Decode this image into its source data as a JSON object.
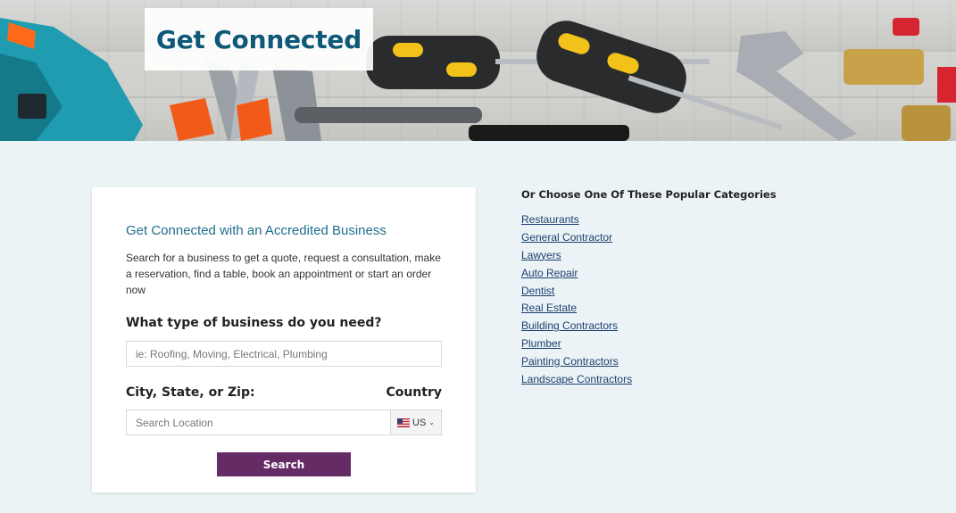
{
  "hero": {
    "title": "Get Connected"
  },
  "card": {
    "heading": "Get Connected with an Accredited Business",
    "description": "Search for a business to get a quote, request a consultation, make a reservation, find a table, book an appointment or start an order now",
    "business_label": "What type of business do you need?",
    "business_placeholder": "ie: Roofing, Moving, Electrical, Plumbing",
    "location_label": "City, State, or Zip:",
    "country_label": "Country",
    "location_placeholder": "Search Location",
    "country_value": "US",
    "search_button": "Search"
  },
  "categories": {
    "heading": "Or Choose One Of These Popular Categories",
    "items": [
      "Restaurants",
      "General Contractor",
      "Lawyers",
      "Auto Repair",
      "Dentist",
      "Real Estate",
      "Building Contractors",
      "Plumber",
      "Painting Contractors",
      "Landscape Contractors"
    ]
  },
  "colors": {
    "accent": "#0d5977",
    "button": "#652b65",
    "link": "#1b3f6e",
    "background": "#ecf3f6"
  }
}
